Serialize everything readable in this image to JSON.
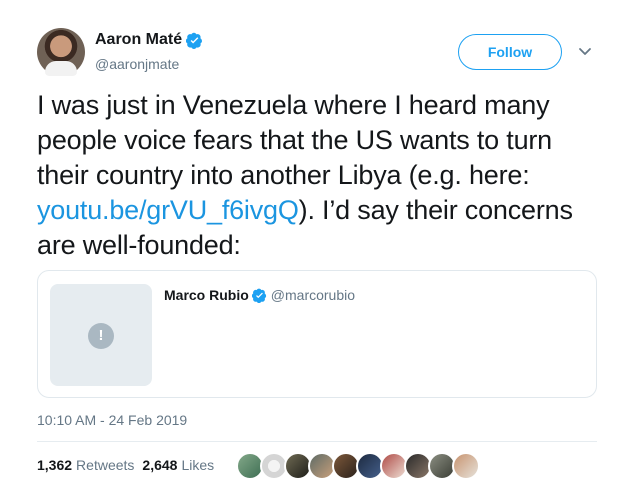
{
  "author": {
    "display_name": "Aaron Maté",
    "handle": "@aaronjmate",
    "avatar_icon": "user-avatar",
    "verified_icon": "verified-badge-icon"
  },
  "actions": {
    "follow_label": "Follow",
    "menu_icon": "chevron-down-icon"
  },
  "tweet": {
    "text_before_link": "I was just in Venezuela where I heard many people voice fears that the US wants to turn their country into another Libya (e.g. here: ",
    "link_text": "youtu.be/grVU_f6ivgQ",
    "text_after_link": "). I’d say their concerns are well-founded:"
  },
  "quoted_tweet": {
    "display_name": "Marco Rubio",
    "handle": "@marcorubio",
    "media_icon": "alert-icon"
  },
  "timestamp": "10:10 AM - 24 Feb 2019",
  "stats": {
    "retweets_count": "1,362",
    "retweets_label": "Retweets",
    "likes_count": "2,648",
    "likes_label": "Likes"
  },
  "likers": [
    "liker-avatar",
    "liker-avatar",
    "liker-avatar",
    "liker-avatar",
    "liker-avatar",
    "liker-avatar",
    "liker-avatar",
    "liker-avatar",
    "liker-avatar",
    "liker-avatar"
  ],
  "colors": {
    "accent": "#1da1f2",
    "link": "#1b95e0",
    "muted_text": "#657786",
    "border": "#e1e8ed"
  }
}
